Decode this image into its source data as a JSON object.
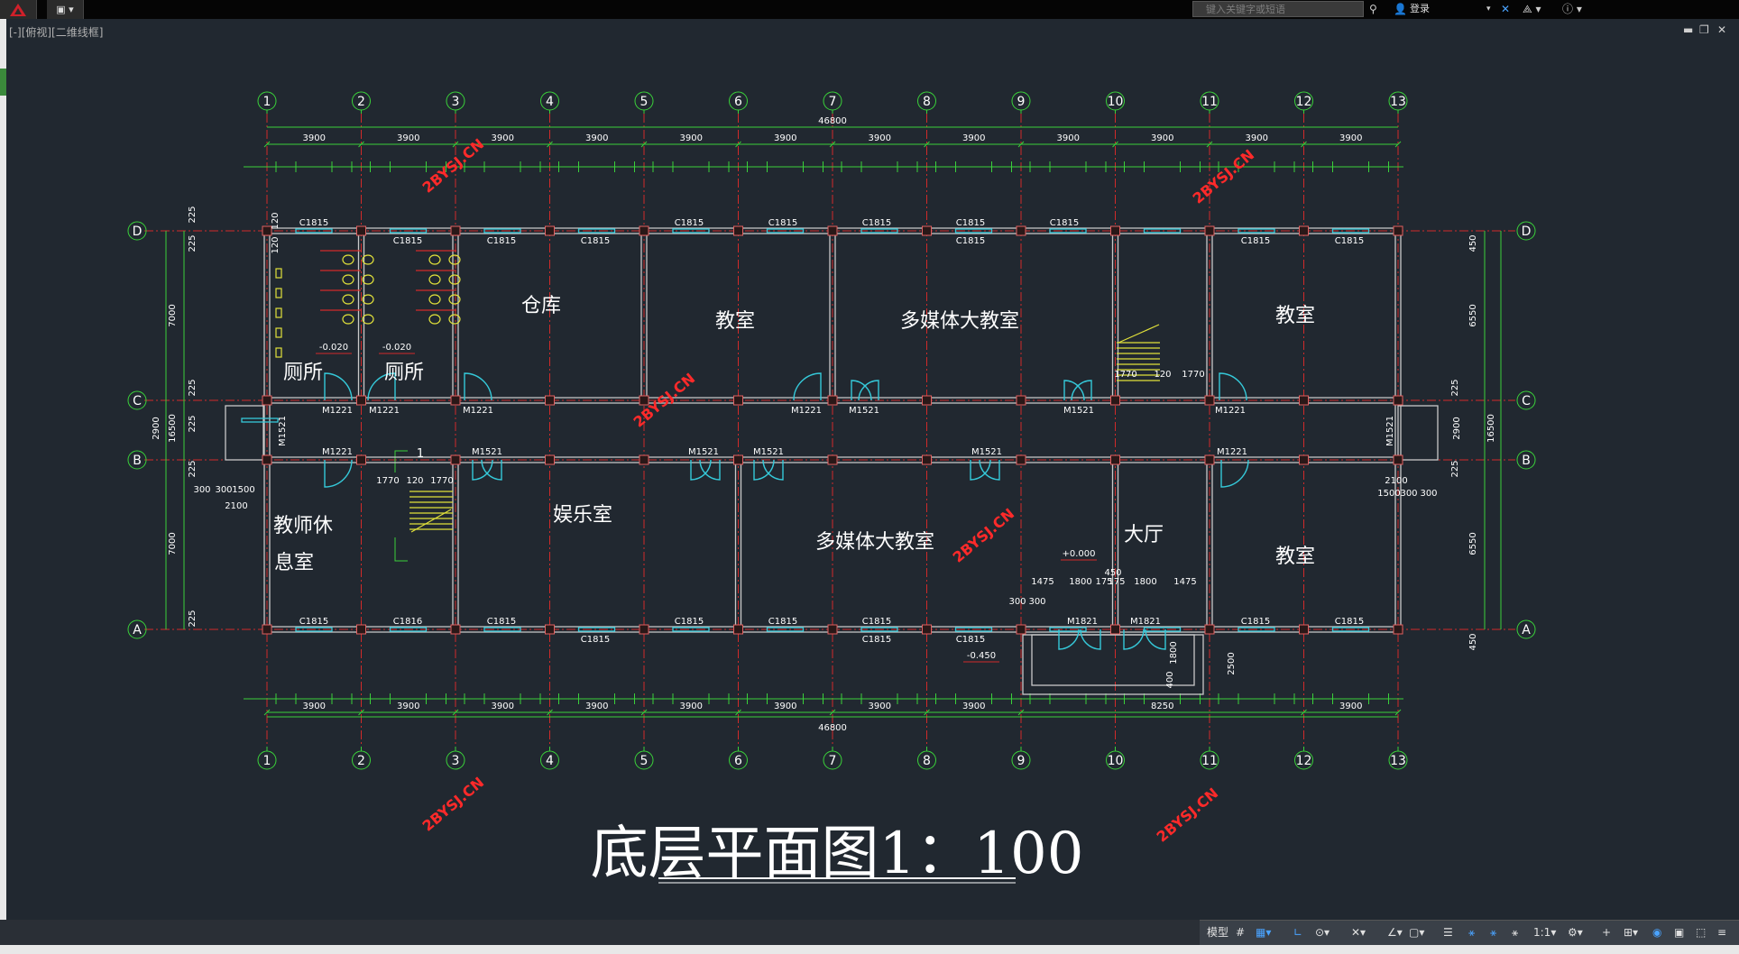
{
  "toolbar": {
    "search_placeholder": "键入关键字或短语",
    "signin_label": "登录"
  },
  "viewport": {
    "label": "[-][俯视][二维线框]"
  },
  "drawing": {
    "title": "底层平面图1：100",
    "total_dim": "46800",
    "grid_numbers": [
      "1",
      "2",
      "3",
      "4",
      "5",
      "6",
      "7",
      "8",
      "9",
      "10",
      "11",
      "12",
      "13"
    ],
    "grid_letters": [
      "D",
      "C",
      "B",
      "A"
    ],
    "top_bay_dims": [
      "3900",
      "3900",
      "3900",
      "3900",
      "3900",
      "3900",
      "3900",
      "3900",
      "3900",
      "3900",
      "3900",
      "3900"
    ],
    "bottom_bay_dims": [
      "3900",
      "3900",
      "3900",
      "3900",
      "3900",
      "3900",
      "3900",
      "3900",
      "3900",
      "8250",
      "3900",
      "3900"
    ],
    "rooms": {
      "toilet_1": "厕所",
      "toilet_2": "厕所",
      "storage": "仓库",
      "classroom_1": "教室",
      "multimedia_1": "多媒体大教室",
      "classroom_2": "教室",
      "lounge_1": "教师休",
      "lounge_2": "息室",
      "recreation": "娱乐室",
      "multimedia_2": "多媒体大教室",
      "hall": "大厅",
      "classroom_3": "教室"
    },
    "window_labels": {
      "top_upper": [
        "C1815",
        "C1815",
        "C1815",
        "C1815",
        "C1815",
        "C1815"
      ],
      "top_lower": [
        "C1815",
        "C1815",
        "C1815",
        "C1815",
        "C1815",
        "C1815"
      ],
      "bottom_upper": [
        "C1815",
        "C1816",
        "C1815",
        "C1815",
        "C1815",
        "C1815",
        "C1815",
        "C1815"
      ],
      "bottom_lower": [
        "C1815",
        "C1815",
        "C1815"
      ]
    },
    "door_labels": {
      "corridor_north": [
        "M1221",
        "M1221",
        "M1221",
        "M1221",
        "M1521",
        "M1521",
        "M1221"
      ],
      "corridor_south": [
        "M1221",
        "M1521",
        "M1521",
        "M1521",
        "M1521",
        "M1221"
      ],
      "entrance": [
        "M1821",
        "M1821"
      ],
      "side": [
        "M1521",
        "M1521"
      ]
    },
    "elevations": [
      "-0.020",
      "-0.020",
      "+0.000",
      "-0.450"
    ],
    "left_dims": [
      "7000",
      "16500",
      "2900",
      "7000",
      "225",
      "225",
      "120",
      "120",
      "225",
      "225",
      "225",
      "225"
    ],
    "right_dims": [
      "6550",
      "16500",
      "2900",
      "6550",
      "450",
      "450",
      "225",
      "225"
    ],
    "stair_dims": [
      "1770",
      "120",
      "1770"
    ],
    "extra_dims": [
      "2100",
      "300",
      "300",
      "1500",
      "2100",
      "1500",
      "300",
      "300",
      "1475",
      "1800",
      "175",
      "175",
      "1800",
      "1475",
      "450",
      "300",
      "300",
      "2500",
      "1800",
      "400"
    ],
    "section_mark": "1",
    "watermark": "2BYSJ.CN"
  }
}
